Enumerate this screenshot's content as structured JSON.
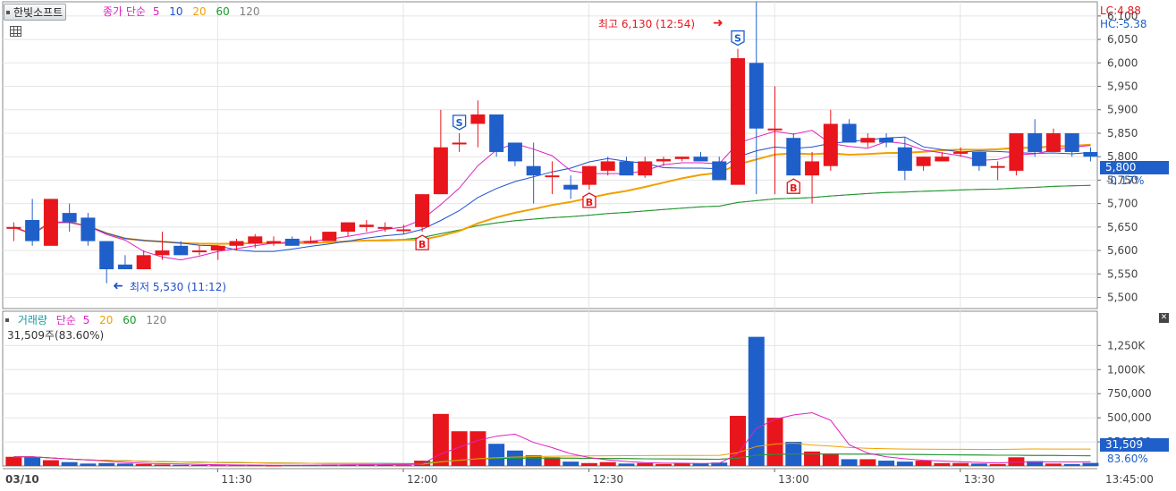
{
  "header": {
    "stock_name": "한빛소프트",
    "legend_prefix": "종가 단순",
    "ma_periods": [
      "5",
      "10",
      "20",
      "60",
      "120"
    ],
    "ma_colors": [
      "#e020c0",
      "#1f4fd0",
      "#f0a000",
      "#1a9a2a",
      "#808080"
    ],
    "lc_label": "LC:4.88",
    "hc_label": "HC:-5.38"
  },
  "annotations": {
    "high_label": "최고 6,130 (12:54)",
    "low_label": "최저 5,530 (11:12)"
  },
  "price_axis": {
    "ticks": [
      "6,100",
      "6,050",
      "6,000",
      "5,950",
      "5,900",
      "5,850",
      "5,800",
      "5,750",
      "5,700",
      "5,650",
      "5,600",
      "5,550",
      "5,500"
    ],
    "current_price": "5,800",
    "change_pct": "-0.17%"
  },
  "volume_panel": {
    "title": "거래량",
    "legend_prefix": "단순",
    "ma_periods": [
      "5",
      "20",
      "60",
      "120"
    ],
    "info": "31,509주(83.60%)",
    "ticks": [
      "1,250K",
      "1,000K",
      "750,000",
      "500,000",
      "250,000"
    ],
    "current_volume": "31,509",
    "current_pct": "83.60%"
  },
  "time_axis": {
    "labels": [
      "03/10",
      "11:30",
      "12:00",
      "12:30",
      "13:00",
      "13:30",
      "13:45:00"
    ]
  },
  "colors": {
    "up": "#e8161c",
    "down": "#1f5fc9",
    "grid": "#e4e4e4",
    "panel_border": "#8a8a8a"
  },
  "chart_data": {
    "type": "candlestick",
    "price_range": [
      5480,
      6115
    ],
    "volume_range": [
      0,
      1420000
    ],
    "candles": [
      {
        "o": 5650,
        "h": 5660,
        "l": 5620,
        "c": 5650,
        "v": 95000
      },
      {
        "o": 5665,
        "h": 5710,
        "l": 5610,
        "c": 5620,
        "v": 95000
      },
      {
        "o": 5610,
        "h": 5710,
        "l": 5610,
        "c": 5710,
        "v": 60000
      },
      {
        "o": 5680,
        "h": 5700,
        "l": 5640,
        "c": 5660,
        "v": 40000
      },
      {
        "o": 5670,
        "h": 5680,
        "l": 5610,
        "c": 5620,
        "v": 25000
      },
      {
        "o": 5620,
        "h": 5620,
        "l": 5530,
        "c": 5560,
        "v": 30000
      },
      {
        "o": 5570,
        "h": 5590,
        "l": 5560,
        "c": 5560,
        "v": 25000
      },
      {
        "o": 5560,
        "h": 5600,
        "l": 5560,
        "c": 5590,
        "v": 20000
      },
      {
        "o": 5590,
        "h": 5640,
        "l": 5580,
        "c": 5600,
        "v": 15000
      },
      {
        "o": 5610,
        "h": 5620,
        "l": 5590,
        "c": 5590,
        "v": 12000
      },
      {
        "o": 5600,
        "h": 5610,
        "l": 5590,
        "c": 5600,
        "v": 10000
      },
      {
        "o": 5600,
        "h": 5610,
        "l": 5580,
        "c": 5610,
        "v": 8000
      },
      {
        "o": 5610,
        "h": 5625,
        "l": 5600,
        "c": 5620,
        "v": 8000
      },
      {
        "o": 5615,
        "h": 5635,
        "l": 5605,
        "c": 5630,
        "v": 8000
      },
      {
        "o": 5615,
        "h": 5630,
        "l": 5610,
        "c": 5620,
        "v": 5000
      },
      {
        "o": 5625,
        "h": 5630,
        "l": 5610,
        "c": 5610,
        "v": 10000
      },
      {
        "o": 5620,
        "h": 5630,
        "l": 5615,
        "c": 5620,
        "v": 10000
      },
      {
        "o": 5620,
        "h": 5640,
        "l": 5620,
        "c": 5640,
        "v": 15000
      },
      {
        "o": 5640,
        "h": 5660,
        "l": 5630,
        "c": 5660,
        "v": 15000
      },
      {
        "o": 5650,
        "h": 5665,
        "l": 5640,
        "c": 5655,
        "v": 15000
      },
      {
        "o": 5650,
        "h": 5660,
        "l": 5640,
        "c": 5650,
        "v": 10000
      },
      {
        "o": 5645,
        "h": 5655,
        "l": 5635,
        "c": 5645,
        "v": 8000
      },
      {
        "o": 5650,
        "h": 5720,
        "l": 5640,
        "c": 5720,
        "v": 55000
      },
      {
        "o": 5720,
        "h": 5900,
        "l": 5720,
        "c": 5820,
        "v": 540000
      },
      {
        "o": 5830,
        "h": 5850,
        "l": 5810,
        "c": 5830,
        "v": 360000
      },
      {
        "o": 5870,
        "h": 5920,
        "l": 5820,
        "c": 5890,
        "v": 360000
      },
      {
        "o": 5890,
        "h": 5890,
        "l": 5800,
        "c": 5810,
        "v": 230000
      },
      {
        "o": 5830,
        "h": 5830,
        "l": 5780,
        "c": 5790,
        "v": 160000
      },
      {
        "o": 5780,
        "h": 5830,
        "l": 5700,
        "c": 5760,
        "v": 110000
      },
      {
        "o": 5760,
        "h": 5790,
        "l": 5720,
        "c": 5760,
        "v": 90000
      },
      {
        "o": 5740,
        "h": 5760,
        "l": 5710,
        "c": 5730,
        "v": 45000
      },
      {
        "o": 5740,
        "h": 5780,
        "l": 5730,
        "c": 5780,
        "v": 30000
      },
      {
        "o": 5770,
        "h": 5800,
        "l": 5760,
        "c": 5790,
        "v": 40000
      },
      {
        "o": 5790,
        "h": 5800,
        "l": 5760,
        "c": 5760,
        "v": 25000
      },
      {
        "o": 5760,
        "h": 5800,
        "l": 5755,
        "c": 5790,
        "v": 30000
      },
      {
        "o": 5790,
        "h": 5800,
        "l": 5780,
        "c": 5795,
        "v": 20000
      },
      {
        "o": 5795,
        "h": 5800,
        "l": 5790,
        "c": 5800,
        "v": 30000
      },
      {
        "o": 5800,
        "h": 5810,
        "l": 5790,
        "c": 5790,
        "v": 25000
      },
      {
        "o": 5790,
        "h": 5800,
        "l": 5750,
        "c": 5750,
        "v": 35000
      },
      {
        "o": 5740,
        "h": 6030,
        "l": 5740,
        "c": 6010,
        "v": 520000
      },
      {
        "o": 6000,
        "h": 6130,
        "l": 5720,
        "c": 5860,
        "v": 1340000
      },
      {
        "o": 5860,
        "h": 5950,
        "l": 5720,
        "c": 5860,
        "v": 500000
      },
      {
        "o": 5840,
        "h": 5850,
        "l": 5760,
        "c": 5760,
        "v": 250000
      },
      {
        "o": 5760,
        "h": 5810,
        "l": 5700,
        "c": 5790,
        "v": 150000
      },
      {
        "o": 5780,
        "h": 5900,
        "l": 5770,
        "c": 5870,
        "v": 130000
      },
      {
        "o": 5870,
        "h": 5880,
        "l": 5830,
        "c": 5830,
        "v": 70000
      },
      {
        "o": 5830,
        "h": 5850,
        "l": 5820,
        "c": 5840,
        "v": 70000
      },
      {
        "o": 5840,
        "h": 5850,
        "l": 5820,
        "c": 5830,
        "v": 55000
      },
      {
        "o": 5820,
        "h": 5840,
        "l": 5750,
        "c": 5770,
        "v": 45000
      },
      {
        "o": 5780,
        "h": 5800,
        "l": 5770,
        "c": 5800,
        "v": 55000
      },
      {
        "o": 5790,
        "h": 5810,
        "l": 5790,
        "c": 5800,
        "v": 30000
      },
      {
        "o": 5810,
        "h": 5820,
        "l": 5800,
        "c": 5810,
        "v": 30000
      },
      {
        "o": 5810,
        "h": 5810,
        "l": 5770,
        "c": 5780,
        "v": 25000
      },
      {
        "o": 5780,
        "h": 5790,
        "l": 5750,
        "c": 5780,
        "v": 20000
      },
      {
        "o": 5770,
        "h": 5850,
        "l": 5760,
        "c": 5850,
        "v": 90000
      },
      {
        "o": 5850,
        "h": 5880,
        "l": 5800,
        "c": 5810,
        "v": 50000
      },
      {
        "o": 5810,
        "h": 5860,
        "l": 5810,
        "c": 5850,
        "v": 25000
      },
      {
        "o": 5850,
        "h": 5850,
        "l": 5800,
        "c": 5810,
        "v": 20000
      },
      {
        "o": 5810,
        "h": 5820,
        "l": 5790,
        "c": 5800,
        "v": 31509
      }
    ],
    "signals": [
      {
        "index": 22,
        "type": "B"
      },
      {
        "index": 24,
        "type": "S"
      },
      {
        "index": 31,
        "type": "B"
      },
      {
        "index": 39,
        "type": "S"
      },
      {
        "index": 42,
        "type": "B"
      }
    ],
    "high_marker": {
      "index": 40,
      "price": 6130,
      "label": "최고 6,130 (12:54)"
    },
    "low_marker": {
      "index": 5,
      "price": 5530,
      "label": "최저 5,530 (11:12)"
    }
  }
}
